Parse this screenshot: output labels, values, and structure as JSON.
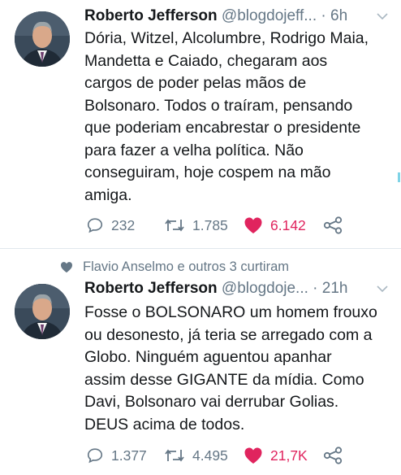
{
  "tweets": [
    {
      "author_name": "Roberto Jefferson",
      "handle": "@blogdojeff...",
      "separator": "·",
      "time": "6h",
      "text": "Dória, Witzel, Alcolumbre, Rodrigo Maia,\nMandetta e Caiado, chegaram aos\ncargos de poder pelas mãos de\nBolsonaro. Todos o traíram, pensando\nque poderiam encabrestar o presidente\npara fazer a velha política. Não\nconseguiram, hoje cospem na mão\namiga.",
      "replies": "232",
      "retweets": "1.785",
      "likes": "6.142",
      "liked": true
    },
    {
      "social_context": "Flavio Anselmo e outros 3 curtiram",
      "author_name": "Roberto Jefferson",
      "handle": "@blogdoje...",
      "separator": "·",
      "time": "21h",
      "text": "Fosse o BOLSONARO um homem frouxo\nou desonesto, já teria se arregado com a\nGlobo. Ninguém aguentou apanhar\nassim desse GIGANTE da mídia. Como\nDavi, Bolsonaro vai derrubar Golias.\nDEUS acima de todos.",
      "replies": "1.377",
      "retweets": "4.495",
      "likes": "21,7K",
      "liked": true
    }
  ],
  "colors": {
    "text": "#14171a",
    "secondary": "#657786",
    "like": "#e0245e",
    "divider": "#e1e8ed"
  },
  "icons": [
    "reply-icon",
    "retweet-icon",
    "heart-icon",
    "share-icon",
    "chevron-down-icon",
    "heart-small-icon"
  ]
}
